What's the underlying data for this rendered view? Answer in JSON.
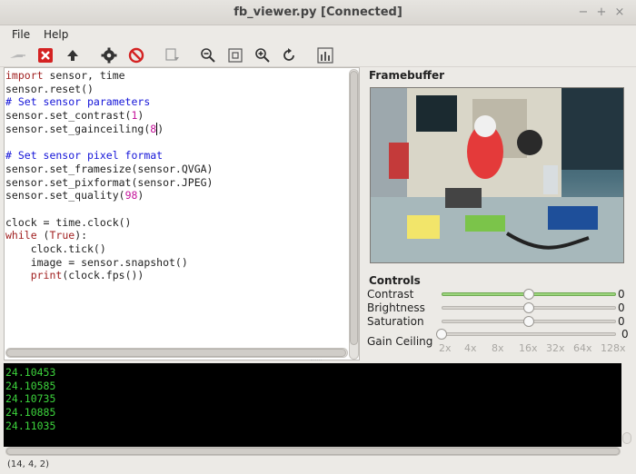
{
  "window": {
    "title": "fb_viewer.py [Connected]",
    "controls": [
      "−",
      "+",
      "×"
    ]
  },
  "menu": {
    "file": "File",
    "help": "Help"
  },
  "toolbar": {
    "icons": [
      "plug-icon",
      "stop-icon",
      "upload-icon",
      "gear-icon",
      "no-entry-icon",
      "export-icon",
      "zoom-out-icon",
      "fit-icon",
      "zoom-in-icon",
      "reset-icon",
      "histogram-icon"
    ]
  },
  "editor": {
    "lines": [
      [
        {
          "t": "import",
          "c": "kw"
        },
        {
          "t": " sensor, time",
          "c": ""
        }
      ],
      [
        {
          "t": "sensor.reset()",
          "c": ""
        }
      ],
      [
        {
          "t": "# Set sensor parameters",
          "c": "cm"
        }
      ],
      [
        {
          "t": "sensor.set_contrast(",
          "c": ""
        },
        {
          "t": "1",
          "c": "num"
        },
        {
          "t": ")",
          "c": ""
        }
      ],
      [
        {
          "t": "sensor.set_gainceiling(",
          "c": ""
        },
        {
          "t": "8",
          "c": "num"
        },
        {
          "t": ")",
          "c": "cursor"
        }
      ],
      [],
      [
        {
          "t": "# Set sensor pixel format",
          "c": "cm"
        }
      ],
      [
        {
          "t": "sensor.set_framesize(sensor.QVGA)",
          "c": ""
        }
      ],
      [
        {
          "t": "sensor.set_pixformat(sensor.JPEG)",
          "c": ""
        }
      ],
      [
        {
          "t": "sensor.set_quality(",
          "c": ""
        },
        {
          "t": "98",
          "c": "num"
        },
        {
          "t": ")",
          "c": ""
        }
      ],
      [],
      [
        {
          "t": "clock = time.clock()",
          "c": ""
        }
      ],
      [
        {
          "t": "while",
          "c": "kw"
        },
        {
          "t": " (",
          "c": ""
        },
        {
          "t": "True",
          "c": "kw"
        },
        {
          "t": "):",
          "c": ""
        }
      ],
      [
        {
          "t": "    clock.tick()",
          "c": ""
        }
      ],
      [
        {
          "t": "    image = sensor.snapshot()",
          "c": ""
        }
      ],
      [
        {
          "t": "    ",
          "c": ""
        },
        {
          "t": "print",
          "c": "kw"
        },
        {
          "t": "(clock.fps())",
          "c": ""
        }
      ]
    ]
  },
  "framebuffer": {
    "label": "Framebuffer"
  },
  "controls": {
    "label": "Controls",
    "sliders": [
      {
        "label": "Contrast",
        "value": "0",
        "level": 0.5,
        "fill": true
      },
      {
        "label": "Brightness",
        "value": "0",
        "level": 0.5,
        "fill": false
      },
      {
        "label": "Saturation",
        "value": "0",
        "level": 0.5,
        "fill": false
      }
    ],
    "gain": {
      "label": "Gain Ceiling",
      "value": "0",
      "level": 0.0,
      "ticks": [
        "2x",
        "4x",
        "8x",
        "16x",
        "32x",
        "64x",
        "128x"
      ]
    }
  },
  "terminal": {
    "lines": [
      "24.10453",
      "24.10585",
      "24.10735",
      "24.10885",
      "24.11035"
    ]
  },
  "status": {
    "cursor": "(14, 4, 2)"
  },
  "colors": {
    "terminal_text": "#3cd33c",
    "keyword": "#a01f1f",
    "comment": "#1414d8",
    "number": "#c4149a",
    "slider_fill": "#9bd47c"
  }
}
